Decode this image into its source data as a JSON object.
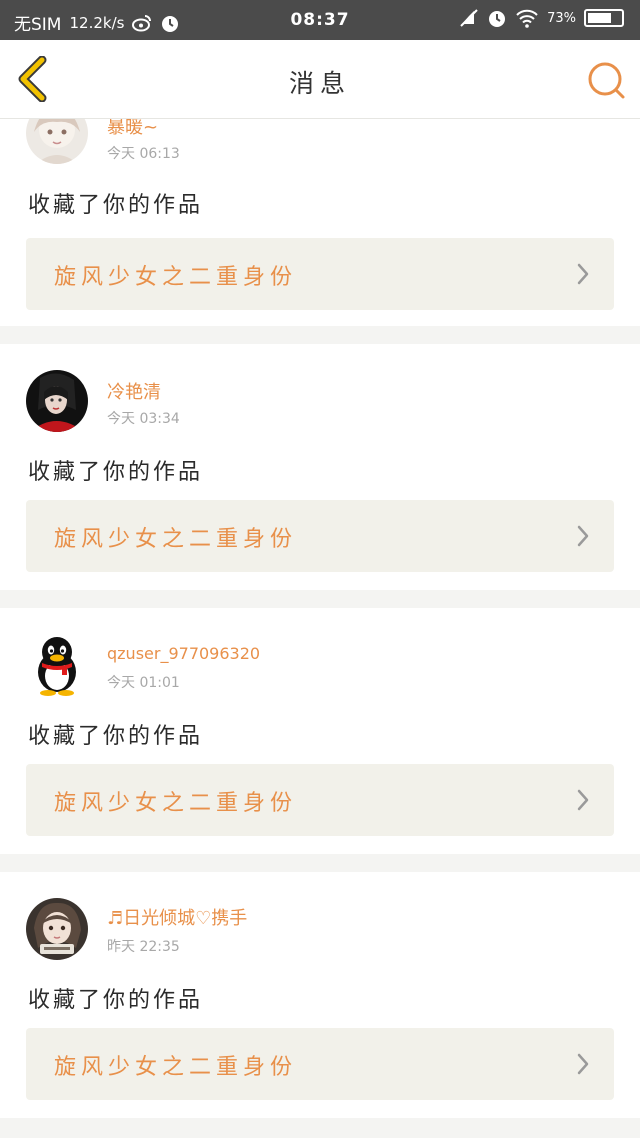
{
  "status_bar": {
    "carrier": "无SIM",
    "speed": "12.2k/s",
    "time": "08:37",
    "battery": "73%",
    "battery_level": 0.73,
    "icons": [
      "weibo-icon",
      "alarm-icon",
      "mute-icon",
      "wifi-icon",
      "battery-icon"
    ]
  },
  "header": {
    "title": "消息",
    "back_icon": "chevron-left-icon",
    "search_icon": "search-icon"
  },
  "colors": {
    "accent": "#e8904a",
    "status_bar": "#4b4b4b",
    "back_arrow": "#f2c200",
    "card_link_bg": "#f2f1ea",
    "page_bg": "#f4f4f2"
  },
  "messages": [
    {
      "username": "暴暖~",
      "time": "今天 06:13",
      "action": "收藏了你的作品",
      "work_title": "旋风少女之二重身份",
      "avatar": "avatar-anime-girl"
    },
    {
      "username": "冷艳清",
      "time": "今天 03:34",
      "action": "收藏了你的作品",
      "work_title": "旋风少女之二重身份",
      "avatar": "avatar-dark-portrait"
    },
    {
      "username": "qzuser_977096320",
      "time": "今天 01:01",
      "action": "收藏了你的作品",
      "work_title": "旋风少女之二重身份",
      "avatar": "penguin-avatar-icon"
    },
    {
      "username": "♬日光倾城♡携手",
      "time": "昨天 22:35",
      "action": "收藏了你的作品",
      "work_title": "旋风少女之二重身份",
      "avatar": "avatar-girl-portrait"
    }
  ]
}
